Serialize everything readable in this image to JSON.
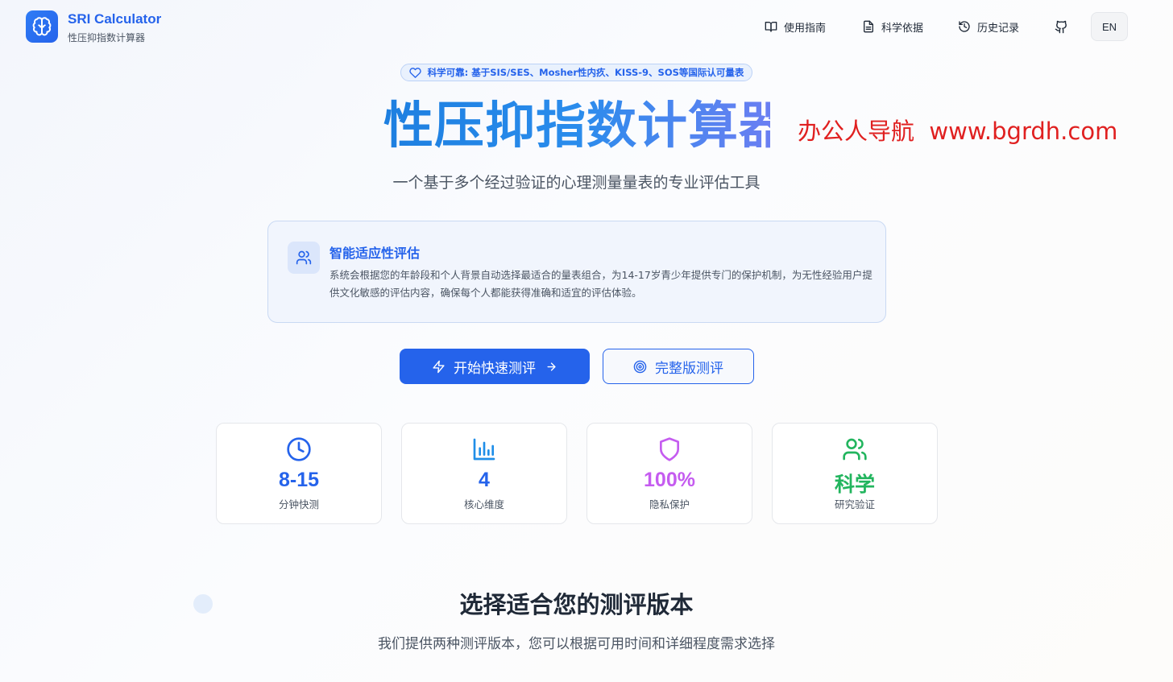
{
  "header": {
    "brand_title": "SRI Calculator",
    "brand_subtitle": "性压抑指数计算器",
    "logo_icon": "brain-icon",
    "nav": [
      {
        "label": "使用指南",
        "icon": "book-icon"
      },
      {
        "label": "科学依据",
        "icon": "document-icon"
      },
      {
        "label": "历史记录",
        "icon": "history-icon"
      }
    ],
    "github_icon": "github-icon",
    "language_label": "EN"
  },
  "hero": {
    "badge": "科学可靠: 基于SIS/SES、Mosher性内疚、KISS-9、SOS等国际认可量表",
    "title": "性压抑指数计算器",
    "watermark": "办公人导航  www.bgrdh.com",
    "subtitle": "一个基于多个经过验证的心理测量量表的专业评估工具"
  },
  "info_card": {
    "title": "智能适应性评估",
    "text": "系统会根据您的年龄段和个人背景自动选择最适合的量表组合，为14-17岁青少年提供专门的保护机制，为无性经验用户提供文化敏感的评估内容，确保每个人都能获得准确和适宜的评估体验。",
    "icon": "users-icon"
  },
  "actions": {
    "quick_label": "开始快速测评",
    "full_label": "完整版测评"
  },
  "stats": [
    {
      "value": "8-15",
      "label": "分钟快测",
      "color": "#2563eb",
      "icon": "clock-icon"
    },
    {
      "value": "4",
      "label": "核心维度",
      "color": "#2563eb",
      "icon": "bar-chart-icon"
    },
    {
      "value": "100%",
      "label": "隐私保护",
      "color": "#c55cf0",
      "icon": "shield-icon"
    },
    {
      "value": "科学",
      "label": "研究验证",
      "color": "#22b55e",
      "icon": "users-icon"
    }
  ],
  "section": {
    "title": "选择适合您的测评版本",
    "subtitle": "我们提供两种测评版本，您可以根据可用时间和详细程度需求选择"
  },
  "colors": {
    "primary": "#2563eb",
    "watermark": "#e02020"
  }
}
